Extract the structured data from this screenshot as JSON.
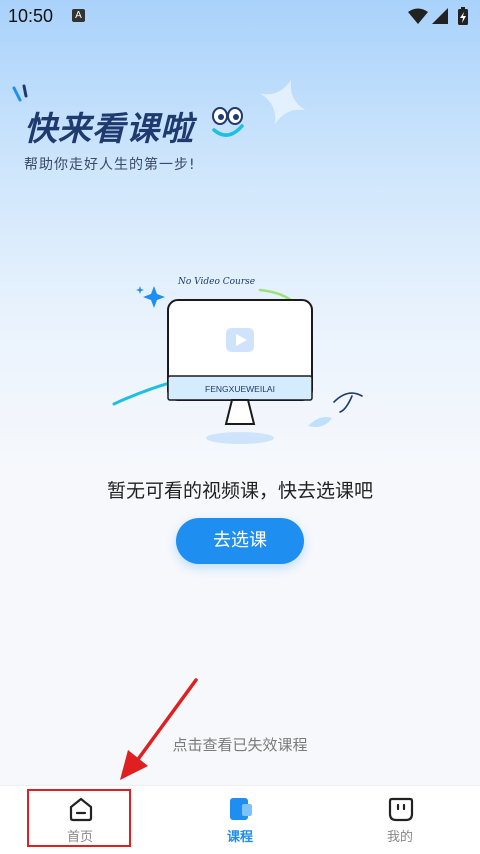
{
  "status_bar": {
    "time": "10:50",
    "badge": "A"
  },
  "hero": {
    "title": "快来看课啦",
    "subtitle": "帮助你走好人生的第一步!"
  },
  "illustration": {
    "brand_text": "FENGXUEWEILAI",
    "script_text": "No Video Course"
  },
  "empty_state": {
    "message": "暂无可看的视频课，快去选课吧",
    "button_label": "去选课",
    "expired_link": "点击查看已失效课程"
  },
  "tabbar": {
    "items": [
      {
        "label": "首页",
        "icon": "home-icon",
        "active": false
      },
      {
        "label": "课程",
        "icon": "course-icon",
        "active": true
      },
      {
        "label": "我的",
        "icon": "profile-icon",
        "active": false
      }
    ]
  },
  "colors": {
    "accent": "#1f8ef1",
    "annotation": "#e02020"
  }
}
